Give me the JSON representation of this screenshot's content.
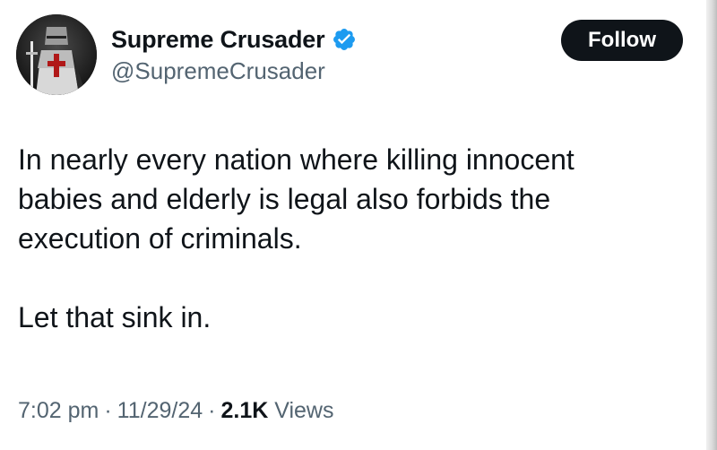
{
  "author": {
    "display_name": "Supreme Crusader",
    "handle": "@SupremeCrusader",
    "verified": true,
    "avatar_icon": "crusader-knight-avatar"
  },
  "actions": {
    "follow_label": "Follow"
  },
  "tweet": {
    "paragraphs": [
      "In nearly every nation where killing innocent babies and elderly is legal also forbids the execution of criminals.",
      "Let that sink in."
    ]
  },
  "meta": {
    "time": "7:02 pm",
    "separator": "·",
    "date": "11/29/24",
    "views_count": "2.1K",
    "views_label": "Views"
  },
  "colors": {
    "text_primary": "#0f1419",
    "text_secondary": "#536471",
    "verified_badge": "#1d9bf0",
    "follow_button_bg": "#0f1419",
    "follow_button_text": "#ffffff"
  }
}
